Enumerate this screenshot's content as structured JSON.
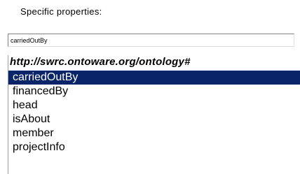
{
  "panel": {
    "label": "Specific properties:"
  },
  "filter": {
    "value": "carriedOutBy"
  },
  "list": {
    "group_header": "http://swrc.ontoware.org/ontology#",
    "selected_index": 0,
    "items": [
      {
        "label": "carriedOutBy"
      },
      {
        "label": "financedBy"
      },
      {
        "label": "head"
      },
      {
        "label": "isAbout"
      },
      {
        "label": "member"
      },
      {
        "label": "projectInfo"
      }
    ]
  },
  "colors": {
    "selection_background": "#0a246a",
    "selection_text": "#ffffff"
  }
}
